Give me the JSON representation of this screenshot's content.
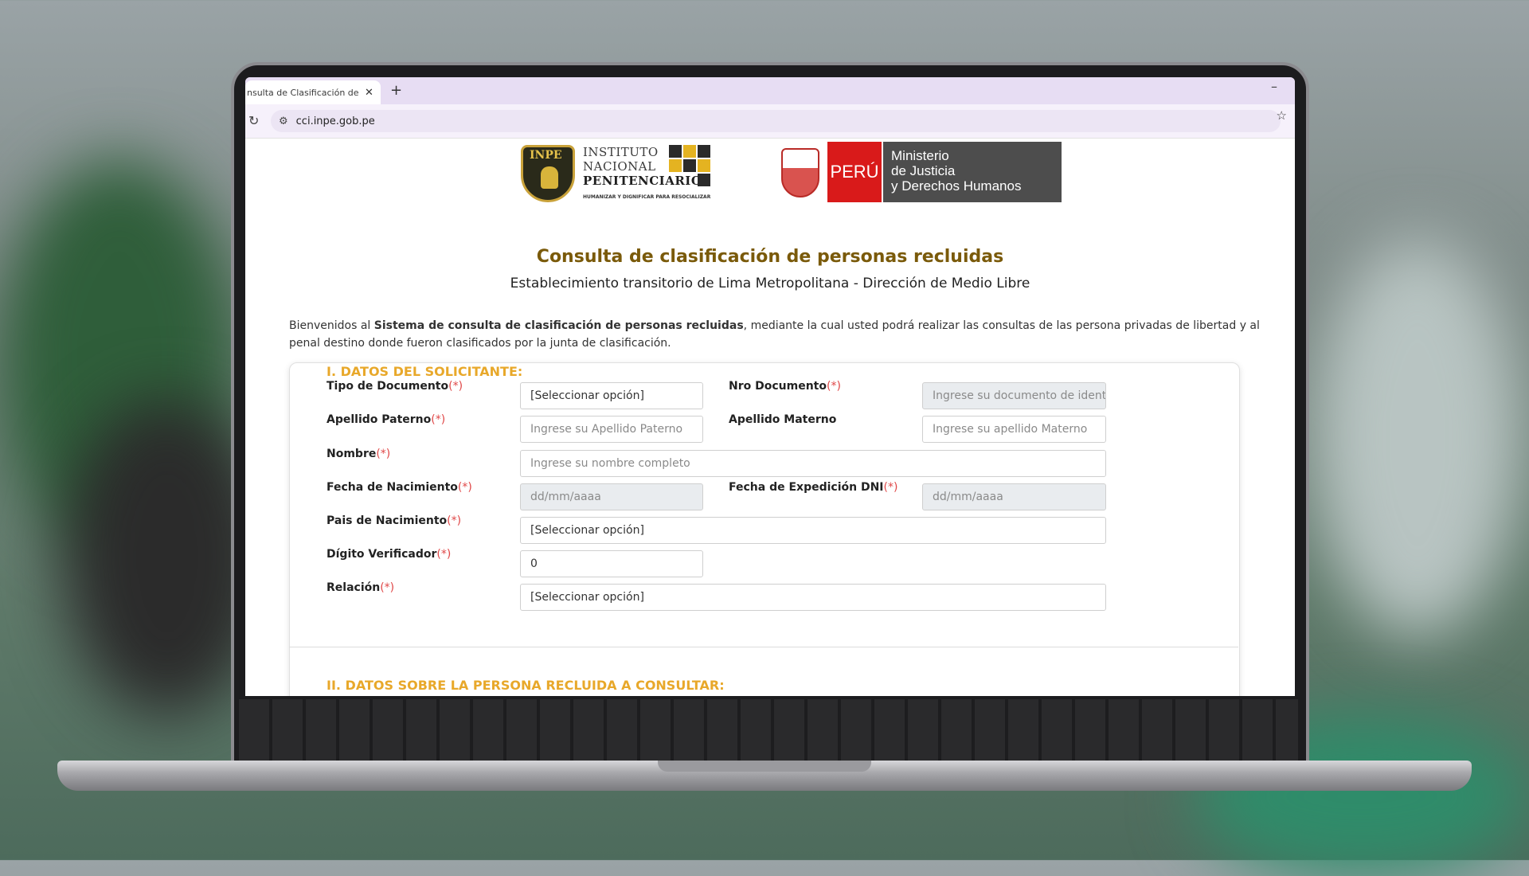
{
  "browser": {
    "tab_title": "nsulta de Clasificación de Inte",
    "tab_close": "✕",
    "new_tab": "+",
    "minimize": "–",
    "url": "cci.inpe.gob.pe"
  },
  "logos": {
    "inpe": {
      "badge": "INPE",
      "line1": "INSTITUTO",
      "line2": "NACIONAL",
      "line3": "PENITENCIARIO",
      "slogan": "HUMANIZAR Y DIGNIFICAR PARA RESOCIALIZAR"
    },
    "peru": {
      "country": "PERÚ",
      "line1": "Ministerio",
      "line2": "de Justicia",
      "line3": "y Derechos Humanos"
    }
  },
  "header": {
    "title": "Consulta de clasificación de personas recluidas",
    "subtitle": "Establecimiento transitorio de Lima Metropolitana - Dirección de Medio Libre"
  },
  "intro": {
    "prefix": "Bienvenidos al ",
    "bold": "Sistema de consulta de clasificación de personas recluidas",
    "suffix": ", mediante la cual usted podrá realizar las consultas de las persona privadas de libertad y al penal destino donde fueron clasificados por la junta de clasificación."
  },
  "form": {
    "required_mark": "(*)",
    "section1": "I. DATOS DEL SOLICITANTE:",
    "section2": "II. DATOS SOBRE LA PERSONA RECLUIDA A CONSULTAR:",
    "tipo_documento": {
      "label": "Tipo de Documento",
      "value": "[Seleccionar opción]"
    },
    "nro_documento": {
      "label": "Nro Documento",
      "placeholder": "Ingrese su documento de identi"
    },
    "apellido_paterno": {
      "label": "Apellido Paterno",
      "placeholder": "Ingrese su Apellido Paterno"
    },
    "apellido_materno": {
      "label": "Apellido Materno",
      "placeholder": "Ingrese su apellido Materno"
    },
    "nombre": {
      "label": "Nombre",
      "placeholder": "Ingrese su nombre completo"
    },
    "fecha_nacimiento": {
      "label": "Fecha de Nacimiento",
      "placeholder": "dd/mm/aaaa"
    },
    "fecha_expedicion": {
      "label": "Fecha de Expedición DNI",
      "placeholder": "dd/mm/aaaa"
    },
    "pais_nacimiento": {
      "label": "Pais de Nacimiento",
      "value": "[Seleccionar opción]"
    },
    "digito_verificador": {
      "label": "Dígito Verificador",
      "value": "0"
    },
    "relacion": {
      "label": "Relación",
      "value": "[Seleccionar opción]"
    }
  },
  "colors": {
    "title": "#7a5a0a",
    "section": "#e8a82a",
    "required": "#e04848",
    "peru_red": "#d91a1a"
  }
}
